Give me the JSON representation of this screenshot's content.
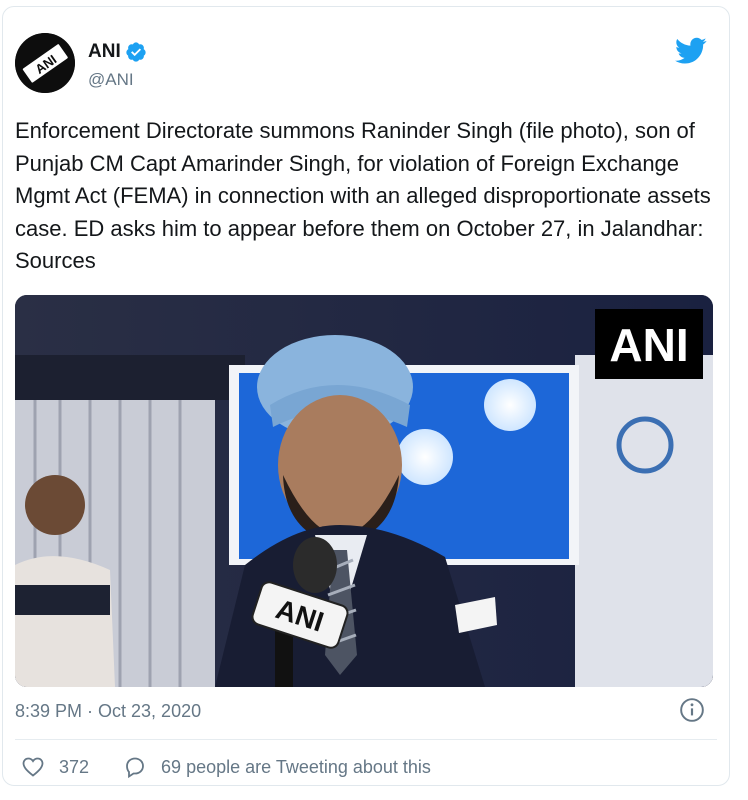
{
  "tweet": {
    "author_name": "ANI",
    "author_handle": "@ANI",
    "avatar_text": "ANI",
    "text": "Enforcement Directorate summons Raninder Singh (file photo), son of Punjab CM Capt Amarinder Singh, for violation of Foreign Exchange Mgmt Act (FEMA) in connection with an alleged disproportionate assets case. ED asks him to appear before them on October 27, in Jalandhar: Sources",
    "media_watermark": "ANI",
    "mic_label": "ANI",
    "timestamp": "8:39 PM · Oct 23, 2020",
    "likes": "372",
    "conversation_text": "69 people are Tweeting about this"
  },
  "colors": {
    "twitter_blue": "#1da1f2",
    "secondary_text": "#657786",
    "primary_text": "#14171a"
  },
  "icons": {
    "verified": "verified-badge-icon",
    "brand": "twitter-bird-icon",
    "info": "info-icon",
    "like": "heart-icon",
    "conversation": "speech-bubble-icon"
  }
}
